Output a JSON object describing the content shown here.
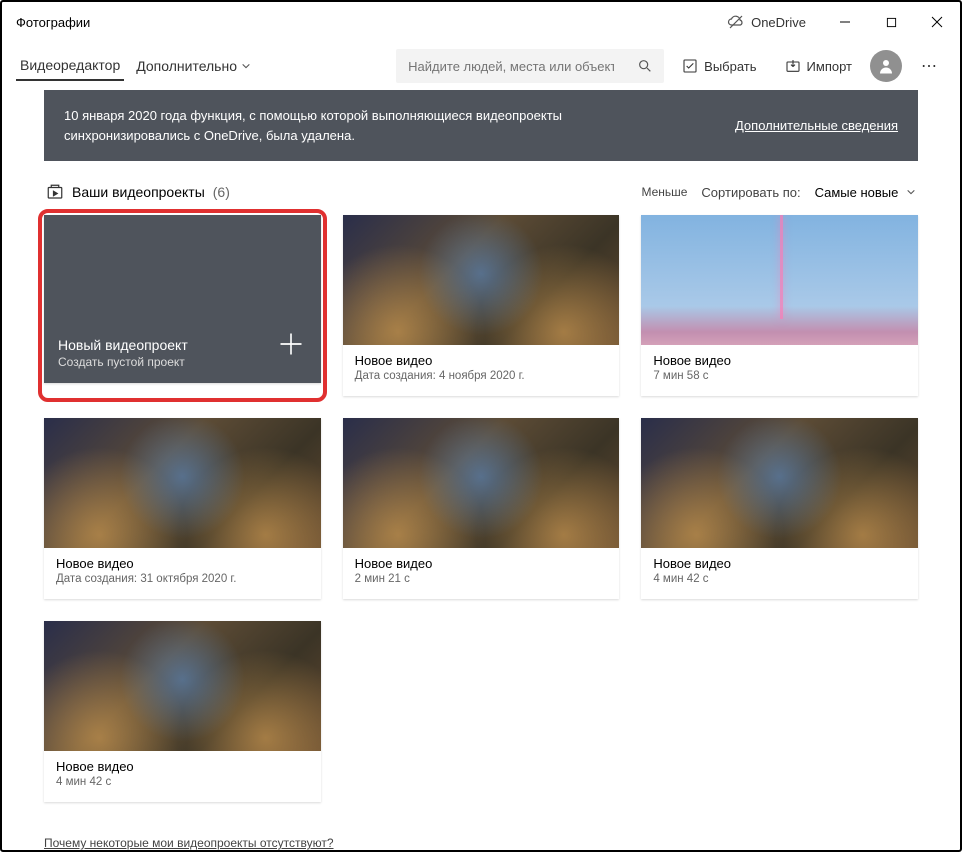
{
  "window": {
    "title": "Фотографии"
  },
  "titlebar": {
    "onedrive": "OneDrive"
  },
  "toolbar": {
    "tab_editor": "Видеоредактор",
    "tab_more": "Дополнительно",
    "search_placeholder": "Найдите людей, места или объект",
    "select": "Выбрать",
    "import": "Импорт"
  },
  "banner": {
    "text": "10 января 2020 года функция, с помощью которой выполняющиеся видеопроекты синхронизировались с OneDrive, была удалена.",
    "link": "Дополнительные сведения"
  },
  "section": {
    "title": "Ваши видеопроекты",
    "count": "(6)",
    "less": "Меньше",
    "sort_label": "Сортировать по:",
    "sort_value": "Самые новые"
  },
  "new_project": {
    "title": "Новый видеопроект",
    "subtitle": "Создать пустой проект"
  },
  "projects": [
    {
      "title": "Новое видео",
      "subtitle": "Дата создания: 4 ноября 2020 г.",
      "thumb": "game"
    },
    {
      "title": "Новое видео",
      "subtitle": "7 мин 58 с",
      "thumb": "sky"
    },
    {
      "title": "Новое видео",
      "subtitle": "Дата создания: 31 октября 2020 г.",
      "thumb": "game"
    },
    {
      "title": "Новое видео",
      "subtitle": "2 мин 21 с",
      "thumb": "game"
    },
    {
      "title": "Новое видео",
      "subtitle": "4 мин 42 с",
      "thumb": "game"
    },
    {
      "title": "Новое видео",
      "subtitle": "4 мин 42 с",
      "thumb": "game"
    }
  ],
  "footer": {
    "link": "Почему некоторые мои видеопроекты отсутствуют?"
  }
}
